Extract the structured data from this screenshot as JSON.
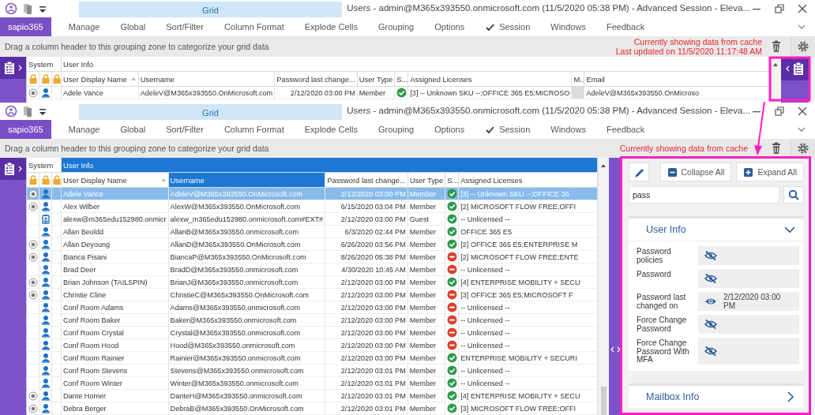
{
  "windows": [
    {
      "title": "Users - admin@M365x393550.onmicrosoft.com (11/5/2020 05:38 PM) - Advanced Session - Eleva...",
      "context_tab": "Grid",
      "ribbon_tabs": [
        {
          "label": "sapio365",
          "selected": true,
          "checked": false
        },
        {
          "label": "Manage",
          "selected": false,
          "checked": false
        },
        {
          "label": "Global",
          "selected": false,
          "checked": false
        },
        {
          "label": "Sort/Filter",
          "selected": false,
          "checked": false
        },
        {
          "label": "Column Format",
          "selected": false,
          "checked": false
        },
        {
          "label": "Explode Cells",
          "selected": false,
          "checked": false
        },
        {
          "label": "Grouping",
          "selected": false,
          "checked": false
        },
        {
          "label": "Options",
          "selected": false,
          "checked": false
        },
        {
          "label": "Session",
          "selected": false,
          "checked": true
        },
        {
          "label": "Windows",
          "selected": false,
          "checked": false
        },
        {
          "label": "Feedback",
          "selected": false,
          "checked": false
        }
      ],
      "grouping_hint": "Drag a column header to this grouping zone to categorize your grid data",
      "cache_notice": [
        "Currently showing data from cache",
        "Last updated on 11/5/2020 11:17:48 AM"
      ],
      "grid": {
        "group_headers": [
          {
            "label": "System",
            "selected": false
          },
          {
            "label": "User Info",
            "selected": false
          }
        ],
        "columns": [
          {
            "label": "User Display Name",
            "kind": "text",
            "sorted": true,
            "selected": false
          },
          {
            "label": "Username",
            "kind": "text",
            "sorted": false,
            "selected": false
          },
          {
            "label": "Password last change...",
            "kind": "date",
            "sorted": false,
            "selected": false
          },
          {
            "label": "User Type",
            "kind": "text",
            "sorted": false,
            "selected": false
          },
          {
            "label": "S...",
            "kind": "status",
            "sorted": false,
            "selected": false
          },
          {
            "label": "Assigned Licenses",
            "kind": "text",
            "sorted": false,
            "selected": false
          },
          {
            "label": "M..",
            "kind": "blank",
            "sorted": false,
            "selected": false
          },
          {
            "label": "Email",
            "kind": "text",
            "sorted": false,
            "selected": false
          }
        ],
        "rows": [
          {
            "system": true,
            "guest": false,
            "enabled": true,
            "selected": false,
            "cells": [
              "Adele Vance",
              "AdeleV@M365x393550.OnMicrosoft.com",
              "2/12/2020 03:00 PM",
              "Member",
              "",
              "[3] -- Unknown SKU --;OFFICE 365 E5;MICROSO",
              "",
              "AdeleV@M365x393550.OnMicroso"
            ]
          }
        ]
      },
      "side_panel": {
        "expanded": false
      }
    },
    {
      "title": "Users - admin@M365x393550.onmicrosoft.com (11/5/2020 05:38 PM) - Advanced Session - Eleva...",
      "context_tab": "Grid",
      "ribbon_tabs": [
        {
          "label": "sapio365",
          "selected": true,
          "checked": false
        },
        {
          "label": "Manage",
          "selected": false,
          "checked": false
        },
        {
          "label": "Global",
          "selected": false,
          "checked": false
        },
        {
          "label": "Sort/Filter",
          "selected": false,
          "checked": false
        },
        {
          "label": "Column Format",
          "selected": false,
          "checked": false
        },
        {
          "label": "Explode Cells",
          "selected": false,
          "checked": false
        },
        {
          "label": "Grouping",
          "selected": false,
          "checked": false
        },
        {
          "label": "Options",
          "selected": false,
          "checked": false
        },
        {
          "label": "Session",
          "selected": false,
          "checked": true
        },
        {
          "label": "Windows",
          "selected": false,
          "checked": false
        },
        {
          "label": "Feedback",
          "selected": false,
          "checked": false
        }
      ],
      "grouping_hint": "Drag a column header to this grouping zone to categorize your grid data",
      "cache_notice": [
        "Currently showing data from cache"
      ],
      "grid": {
        "group_headers": [
          {
            "label": "System",
            "selected": false
          },
          {
            "label": "User Info",
            "selected": true
          }
        ],
        "columns": [
          {
            "label": "User Display Name",
            "kind": "text",
            "sorted": true,
            "selected": false
          },
          {
            "label": "Username",
            "kind": "text",
            "sorted": false,
            "selected": true
          },
          {
            "label": "Password last change...",
            "kind": "date",
            "sorted": false,
            "selected": false
          },
          {
            "label": "User Type",
            "kind": "text",
            "sorted": false,
            "selected": false
          },
          {
            "label": "S...",
            "kind": "status",
            "sorted": false,
            "selected": false
          },
          {
            "label": "Assigned Licenses",
            "kind": "text",
            "sorted": false,
            "selected": false
          }
        ],
        "rows": [
          {
            "system": true,
            "guest": false,
            "enabled": true,
            "selected": true,
            "cells": [
              "Adele Vance",
              "AdeleV@M365x393550.OnMicrosoft.com",
              "2/12/2020 03:00 PM",
              "Member",
              "",
              "[3] -- Unknown SKU --;OFFICE 36"
            ]
          },
          {
            "system": true,
            "guest": false,
            "enabled": true,
            "selected": false,
            "cells": [
              "Alex Wilber",
              "AlexW@M365x393550.OnMicrosoft.com",
              "6/15/2020 03:04 PM",
              "Member",
              "",
              "[2] MICROSOFT FLOW FREE;OFFI"
            ]
          },
          {
            "system": false,
            "guest": true,
            "enabled": true,
            "selected": false,
            "cells": [
              "alexw@m365edu152980.onmicr",
              "alexw_m365edu152980.onmicrosoft.com#EXT#",
              "2/12/2020 03:00 PM",
              "Guest",
              "",
              "-- Unlicensed --"
            ]
          },
          {
            "system": false,
            "guest": false,
            "enabled": true,
            "selected": false,
            "cells": [
              "Allan Beoldd",
              "AllanB@M365x393550.onmicrosoft.com",
              "6/3/2020 02:44 PM",
              "Member",
              "",
              "OFFICE 365 E5"
            ]
          },
          {
            "system": true,
            "guest": false,
            "enabled": true,
            "selected": false,
            "cells": [
              "Allan Deyoung",
              "AllanD@M365x393550.OnMicrosoft.com",
              "6/26/2020 03:56 PM",
              "Member",
              "",
              "[2] OFFICE 365 E5;ENTERPRISE M"
            ]
          },
          {
            "system": true,
            "guest": false,
            "enabled": false,
            "selected": false,
            "cells": [
              "Bianca Pisani",
              "BiancaP@M365x393550.OnMicrosoft.com",
              "8/26/2020 05:38 PM",
              "Member",
              "",
              "[2] MICROSOFT FLOW FREE;ENTE"
            ]
          },
          {
            "system": false,
            "guest": false,
            "enabled": false,
            "selected": false,
            "cells": [
              "Brad Deer",
              "BradD@M365x393550.onmicrosoft.com",
              "4/30/2020 10:45 AM",
              "Member",
              "",
              "-- Unlicensed --"
            ]
          },
          {
            "system": true,
            "guest": false,
            "enabled": true,
            "selected": false,
            "cells": [
              "Brian Johnson (TAILSPIN)",
              "BrianJ@M365x393550.onmicrosoft.com",
              "2/12/2020 03:00 PM",
              "Member",
              "",
              "[4] ENTERPRISE MOBILITY + SECU"
            ]
          },
          {
            "system": true,
            "guest": false,
            "enabled": false,
            "selected": false,
            "cells": [
              "Christie Cline",
              "ChristieC@M365x393550.OnMicrosoft.com",
              "2/12/2020 03:00 PM",
              "Member",
              "",
              "[3] OFFICE 365 E5;MICROSOFT F"
            ]
          },
          {
            "system": false,
            "guest": false,
            "enabled": false,
            "selected": false,
            "cells": [
              "Conf Room Adams",
              "Adams@M365x393550.onmicrosoft.com",
              "2/12/2020 03:00 PM",
              "Member",
              "",
              "-- Unlicensed --"
            ]
          },
          {
            "system": false,
            "guest": false,
            "enabled": false,
            "selected": false,
            "cells": [
              "Conf Room Baker",
              "Baker@M365x393550.onmicrosoft.com",
              "2/12/2020 03:00 PM",
              "Member",
              "",
              "-- Unlicensed --"
            ]
          },
          {
            "system": false,
            "guest": false,
            "enabled": false,
            "selected": false,
            "cells": [
              "Conf Room Crystal",
              "Crystal@M365x393550.onmicrosoft.com",
              "2/12/2020 03:00 PM",
              "Member",
              "",
              "-- Unlicensed --"
            ]
          },
          {
            "system": false,
            "guest": false,
            "enabled": false,
            "selected": false,
            "cells": [
              "Conf Room Hood",
              "Hood@M365x393550.onmicrosoft.com",
              "2/12/2020 03:00 PM",
              "Member",
              "",
              "-- Unlicensed --"
            ]
          },
          {
            "system": false,
            "guest": false,
            "enabled": true,
            "selected": false,
            "cells": [
              "Conf Room Rainier",
              "Rainier@M365x393550.onmicrosoft.com",
              "2/12/2020 03:00 PM",
              "Member",
              "",
              "ENTERPRISE MOBILITY + SECURI"
            ]
          },
          {
            "system": false,
            "guest": false,
            "enabled": true,
            "selected": false,
            "cells": [
              "Conf Room Stevens",
              "Stevens@M365x393550.onmicrosoft.com",
              "2/12/2020 03:01 PM",
              "Member",
              "",
              "-- Unlicensed --"
            ]
          },
          {
            "system": false,
            "guest": false,
            "enabled": true,
            "selected": false,
            "cells": [
              "Conf Room Winter",
              "Winter@M365x393550.onmicrosoft.com",
              "2/12/2020 03:01 PM",
              "Member",
              "",
              "-- Unlicensed --"
            ]
          },
          {
            "system": true,
            "guest": false,
            "enabled": true,
            "selected": false,
            "cells": [
              "Dante Homer",
              "DanteH@M365x393550.onmicrosoft.com",
              "2/12/2020 03:01 PM",
              "Member",
              "",
              "[4] ENTERPRISE MOBILITY + SECU"
            ]
          },
          {
            "system": true,
            "guest": false,
            "enabled": true,
            "selected": false,
            "cells": [
              "Debra Berger",
              "DebraB@M365x393550.OnMicrosoft.com",
              "2/12/2020 03:01 PM",
              "Member",
              "",
              "[3] MICROSOFT FLOW FREE;OFFI"
            ]
          }
        ]
      },
      "side_panel": {
        "expanded": true,
        "collapse_label": "Collapse All",
        "expand_label": "Expand All",
        "search_value": "pass",
        "sections": [
          {
            "title": "User Info",
            "expanded": true,
            "fields": [
              {
                "label": "Password policies",
                "hidden": true
              },
              {
                "label": "Password",
                "hidden": true
              },
              {
                "label": "Password last changed on",
                "hidden": false,
                "value": "2/12/2020 03:00 PM"
              },
              {
                "label": "Force Change Password",
                "hidden": true
              },
              {
                "label": "Force Change Password With MFA",
                "hidden": true
              }
            ]
          },
          {
            "title": "Mailbox Info",
            "expanded": false
          }
        ]
      }
    }
  ]
}
